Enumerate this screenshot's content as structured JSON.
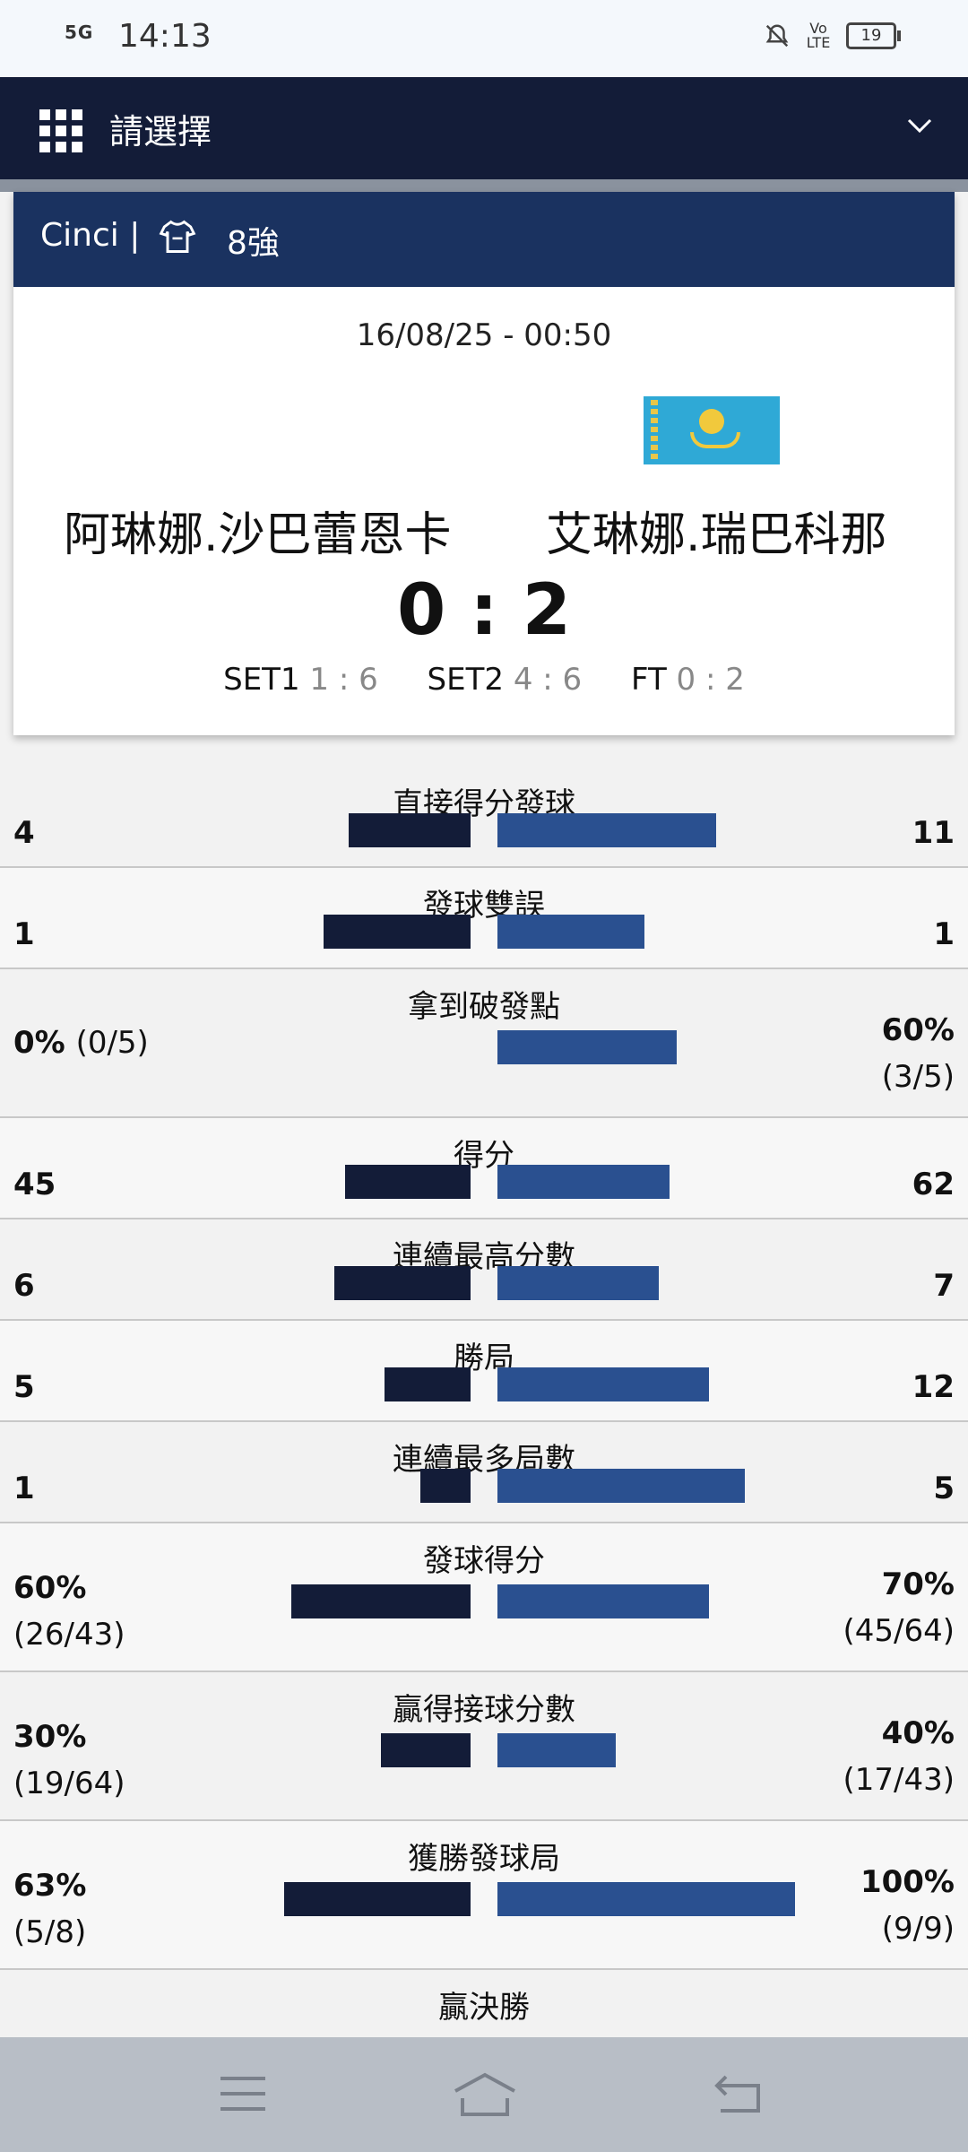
{
  "status": {
    "signal": "5G",
    "time": "14:13",
    "battery": "19",
    "volte": "Vo LTE"
  },
  "appbar": {
    "title": "請選擇"
  },
  "match": {
    "league": "Cinci |",
    "round": "8強",
    "datetime": "16/08/25 - 00:50",
    "player1": "阿琳娜.沙巴蕾恩卡",
    "player2": "艾琳娜.瑞巴科那",
    "score": "0 : 2",
    "sets": [
      {
        "label": "SET1",
        "score": "1 : 6"
      },
      {
        "label": "SET2",
        "score": "4 : 6"
      },
      {
        "label": "FT",
        "score": "0 : 2"
      }
    ]
  },
  "stats": [
    {
      "label": "直接得分發球",
      "left": "4",
      "right": "11",
      "left_frac": 0.34,
      "right_frac": 0.61
    },
    {
      "label": "發球雙誤",
      "left": "1",
      "right": "1",
      "left_frac": 0.41,
      "right_frac": 0.41
    },
    {
      "label": "拿到破發點",
      "left": "0%",
      "left_sub": "(0/5)",
      "right": "60%",
      "right_sub": "(3/5)",
      "left_frac": 0.0,
      "right_frac": 0.5
    },
    {
      "label": "得分",
      "left": "45",
      "right": "62",
      "left_frac": 0.35,
      "right_frac": 0.48
    },
    {
      "label": "連續最高分數",
      "left": "6",
      "right": "7",
      "left_frac": 0.38,
      "right_frac": 0.45
    },
    {
      "label": "勝局",
      "left": "5",
      "right": "12",
      "left_frac": 0.24,
      "right_frac": 0.59
    },
    {
      "label": "連續最多局數",
      "left": "1",
      "right": "5",
      "left_frac": 0.14,
      "right_frac": 0.69
    },
    {
      "label": "發球得分",
      "left": "60%",
      "left_sub": "(26/43)",
      "right": "70%",
      "right_sub": "(45/64)",
      "left_frac": 0.5,
      "right_frac": 0.59
    },
    {
      "label": "贏得接球分數",
      "left": "30%",
      "left_sub": "(19/64)",
      "right": "40%",
      "right_sub": "(17/43)",
      "left_frac": 0.25,
      "right_frac": 0.33
    },
    {
      "label": "獲勝發球局",
      "left": "63%",
      "left_sub": "(5/8)",
      "right": "100%",
      "right_sub": "(9/9)",
      "left_frac": 0.52,
      "right_frac": 0.83
    },
    {
      "label": "贏決勝",
      "left": "",
      "right": "",
      "left_frac": 0.0,
      "right_frac": 0.0
    }
  ]
}
